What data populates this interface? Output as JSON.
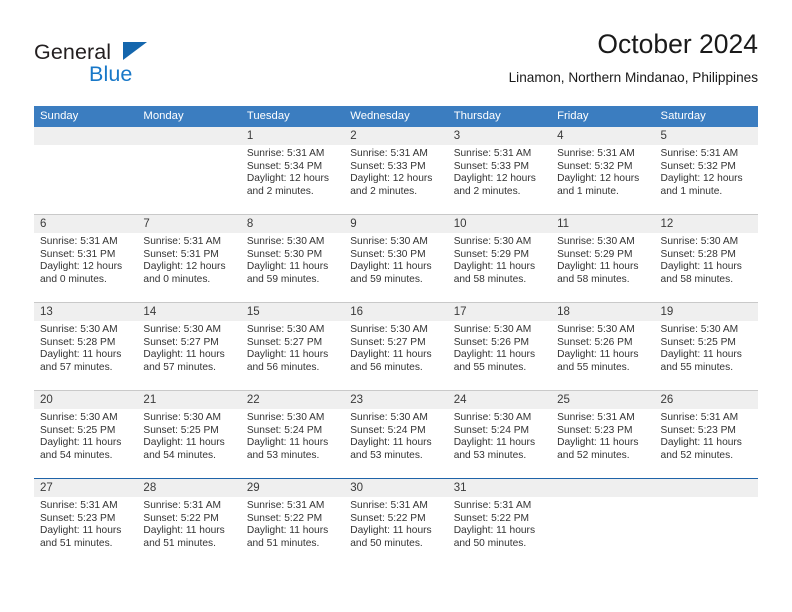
{
  "brand": {
    "name_top": "General",
    "name_bottom": "Blue",
    "accent_color": "#1878c8",
    "triangle_color": "#1466ad"
  },
  "header": {
    "title": "October 2024",
    "subtitle": "Linamon, Northern Mindanao, Philippines"
  },
  "calendar": {
    "header_bg": "#3b7dc0",
    "daynum_bg": "#efefef",
    "weekday_headers": [
      "Sunday",
      "Monday",
      "Tuesday",
      "Wednesday",
      "Thursday",
      "Friday",
      "Saturday"
    ],
    "weeks": [
      [
        {
          "day": "",
          "lines": []
        },
        {
          "day": "",
          "lines": []
        },
        {
          "day": "1",
          "lines": [
            "Sunrise: 5:31 AM",
            "Sunset: 5:34 PM",
            "Daylight: 12 hours and 2 minutes."
          ]
        },
        {
          "day": "2",
          "lines": [
            "Sunrise: 5:31 AM",
            "Sunset: 5:33 PM",
            "Daylight: 12 hours and 2 minutes."
          ]
        },
        {
          "day": "3",
          "lines": [
            "Sunrise: 5:31 AM",
            "Sunset: 5:33 PM",
            "Daylight: 12 hours and 2 minutes."
          ]
        },
        {
          "day": "4",
          "lines": [
            "Sunrise: 5:31 AM",
            "Sunset: 5:32 PM",
            "Daylight: 12 hours and 1 minute."
          ]
        },
        {
          "day": "5",
          "lines": [
            "Sunrise: 5:31 AM",
            "Sunset: 5:32 PM",
            "Daylight: 12 hours and 1 minute."
          ]
        }
      ],
      [
        {
          "day": "6",
          "lines": [
            "Sunrise: 5:31 AM",
            "Sunset: 5:31 PM",
            "Daylight: 12 hours and 0 minutes."
          ]
        },
        {
          "day": "7",
          "lines": [
            "Sunrise: 5:31 AM",
            "Sunset: 5:31 PM",
            "Daylight: 12 hours and 0 minutes."
          ]
        },
        {
          "day": "8",
          "lines": [
            "Sunrise: 5:30 AM",
            "Sunset: 5:30 PM",
            "Daylight: 11 hours and 59 minutes."
          ]
        },
        {
          "day": "9",
          "lines": [
            "Sunrise: 5:30 AM",
            "Sunset: 5:30 PM",
            "Daylight: 11 hours and 59 minutes."
          ]
        },
        {
          "day": "10",
          "lines": [
            "Sunrise: 5:30 AM",
            "Sunset: 5:29 PM",
            "Daylight: 11 hours and 58 minutes."
          ]
        },
        {
          "day": "11",
          "lines": [
            "Sunrise: 5:30 AM",
            "Sunset: 5:29 PM",
            "Daylight: 11 hours and 58 minutes."
          ]
        },
        {
          "day": "12",
          "lines": [
            "Sunrise: 5:30 AM",
            "Sunset: 5:28 PM",
            "Daylight: 11 hours and 58 minutes."
          ]
        }
      ],
      [
        {
          "day": "13",
          "lines": [
            "Sunrise: 5:30 AM",
            "Sunset: 5:28 PM",
            "Daylight: 11 hours and 57 minutes."
          ]
        },
        {
          "day": "14",
          "lines": [
            "Sunrise: 5:30 AM",
            "Sunset: 5:27 PM",
            "Daylight: 11 hours and 57 minutes."
          ]
        },
        {
          "day": "15",
          "lines": [
            "Sunrise: 5:30 AM",
            "Sunset: 5:27 PM",
            "Daylight: 11 hours and 56 minutes."
          ]
        },
        {
          "day": "16",
          "lines": [
            "Sunrise: 5:30 AM",
            "Sunset: 5:27 PM",
            "Daylight: 11 hours and 56 minutes."
          ]
        },
        {
          "day": "17",
          "lines": [
            "Sunrise: 5:30 AM",
            "Sunset: 5:26 PM",
            "Daylight: 11 hours and 55 minutes."
          ]
        },
        {
          "day": "18",
          "lines": [
            "Sunrise: 5:30 AM",
            "Sunset: 5:26 PM",
            "Daylight: 11 hours and 55 minutes."
          ]
        },
        {
          "day": "19",
          "lines": [
            "Sunrise: 5:30 AM",
            "Sunset: 5:25 PM",
            "Daylight: 11 hours and 55 minutes."
          ]
        }
      ],
      [
        {
          "day": "20",
          "lines": [
            "Sunrise: 5:30 AM",
            "Sunset: 5:25 PM",
            "Daylight: 11 hours and 54 minutes."
          ]
        },
        {
          "day": "21",
          "lines": [
            "Sunrise: 5:30 AM",
            "Sunset: 5:25 PM",
            "Daylight: 11 hours and 54 minutes."
          ]
        },
        {
          "day": "22",
          "lines": [
            "Sunrise: 5:30 AM",
            "Sunset: 5:24 PM",
            "Daylight: 11 hours and 53 minutes."
          ]
        },
        {
          "day": "23",
          "lines": [
            "Sunrise: 5:30 AM",
            "Sunset: 5:24 PM",
            "Daylight: 11 hours and 53 minutes."
          ]
        },
        {
          "day": "24",
          "lines": [
            "Sunrise: 5:30 AM",
            "Sunset: 5:24 PM",
            "Daylight: 11 hours and 53 minutes."
          ]
        },
        {
          "day": "25",
          "lines": [
            "Sunrise: 5:31 AM",
            "Sunset: 5:23 PM",
            "Daylight: 11 hours and 52 minutes."
          ]
        },
        {
          "day": "26",
          "lines": [
            "Sunrise: 5:31 AM",
            "Sunset: 5:23 PM",
            "Daylight: 11 hours and 52 minutes."
          ]
        }
      ],
      [
        {
          "day": "27",
          "lines": [
            "Sunrise: 5:31 AM",
            "Sunset: 5:23 PM",
            "Daylight: 11 hours and 51 minutes."
          ]
        },
        {
          "day": "28",
          "lines": [
            "Sunrise: 5:31 AM",
            "Sunset: 5:22 PM",
            "Daylight: 11 hours and 51 minutes."
          ]
        },
        {
          "day": "29",
          "lines": [
            "Sunrise: 5:31 AM",
            "Sunset: 5:22 PM",
            "Daylight: 11 hours and 51 minutes."
          ]
        },
        {
          "day": "30",
          "lines": [
            "Sunrise: 5:31 AM",
            "Sunset: 5:22 PM",
            "Daylight: 11 hours and 50 minutes."
          ]
        },
        {
          "day": "31",
          "lines": [
            "Sunrise: 5:31 AM",
            "Sunset: 5:22 PM",
            "Daylight: 11 hours and 50 minutes."
          ]
        },
        {
          "day": "",
          "lines": []
        },
        {
          "day": "",
          "lines": []
        }
      ]
    ]
  }
}
